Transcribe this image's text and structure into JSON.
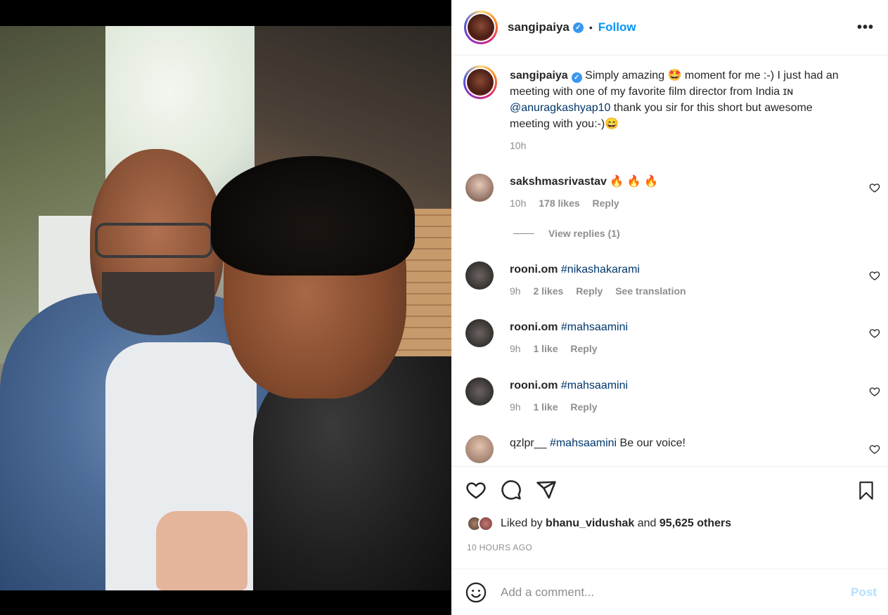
{
  "post": {
    "username": "sangipaiya",
    "follow_label": "Follow",
    "more_label": "•••",
    "dot": "•",
    "verified_mark": "✓",
    "caption": {
      "username": "sangipaiya",
      "text_before": "Simply amazing 🤩 moment for me :-) I just had an meeting with one of my favorite film director from India ɪɴ ",
      "mention": "@anuragkashyap10",
      "text_after": " thank you sir for this short but awesome meeting with you:-)😄",
      "time": "10h"
    }
  },
  "comments": [
    {
      "username": "sakshmasrivastav",
      "text": "🔥 🔥 🔥",
      "time": "10h",
      "likes": "178 likes",
      "reply": "Reply"
    },
    {
      "username": "rooni.om",
      "tag": "#nikashakarami",
      "text": "",
      "time": "9h",
      "likes": "2 likes",
      "reply": "Reply",
      "translate": "See translation"
    },
    {
      "username": "rooni.om",
      "tag": "#mahsaamini",
      "text": "",
      "time": "9h",
      "likes": "1 like",
      "reply": "Reply"
    },
    {
      "username": "rooni.om",
      "tag": "#mahsaamini",
      "text": "",
      "time": "9h",
      "likes": "1 like",
      "reply": "Reply"
    },
    {
      "username": "qzlpr__",
      "tag": "#mahsaamini",
      "text": " Be our voice!",
      "time": "",
      "likes": "",
      "reply": ""
    }
  ],
  "view_replies": "View replies (1)",
  "likes_summary": {
    "prefix": "Liked by ",
    "user": "bhanu_vidushak",
    "middle": " and ",
    "count": "95,625 others"
  },
  "timestamp": "10 HOURS AGO",
  "compose": {
    "placeholder": "Add a comment...",
    "post_label": "Post"
  },
  "icons": {
    "like": "heart-icon",
    "comment": "comment-icon",
    "share": "share-icon",
    "save": "bookmark-icon",
    "emoji": "emoji-icon"
  },
  "colors": {
    "link": "#00376b",
    "follow": "#0095f6",
    "post_disabled": "#b2dffc",
    "muted": "#8e8e8e",
    "verified": "#3897f0"
  }
}
